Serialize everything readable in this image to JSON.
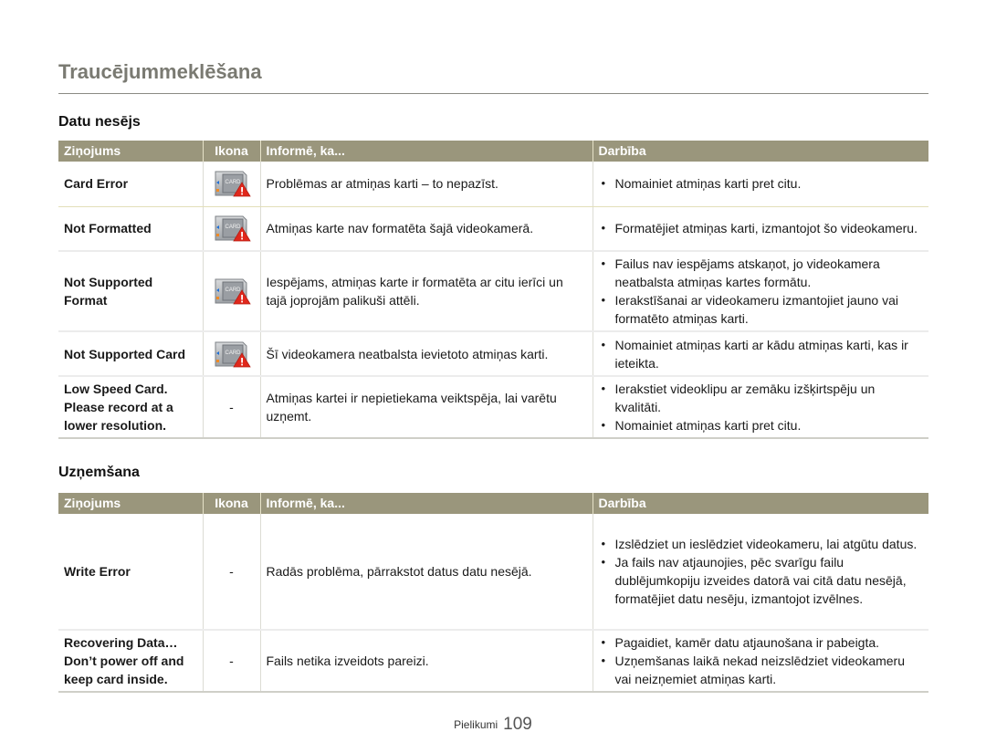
{
  "page": {
    "title": "Traucējummeklēšana",
    "footer": {
      "label": "Pielikumi",
      "page_number": "109"
    }
  },
  "colors": {
    "header_bg": "#9a967c",
    "header_text": "#ffffff",
    "title_text": "#7a7a72",
    "warning_red": "#e0281c"
  },
  "sections": [
    {
      "title": "Datu nesējs",
      "headers": {
        "message": "Ziņojums",
        "icon": "Ikona",
        "info": "Informē, ka...",
        "action": "Darbība"
      },
      "rows": [
        {
          "message": "Card Error",
          "icon": "card-error-icon",
          "info": "Problēmas ar atmiņas karti – to nepazīst.",
          "actions": [
            "Nomainiet atmiņas karti pret citu."
          ]
        },
        {
          "message": "Not Formatted",
          "icon": "card-error-icon",
          "info": "Atmiņas karte nav formatēta šajā videokamerā.",
          "actions": [
            "Formatējiet atmiņas karti, izmantojot šo videokameru."
          ]
        },
        {
          "message": "Not Supported Format",
          "icon": "card-error-icon",
          "info": "Iespējams, atmiņas karte ir formatēta ar citu ierīci un tajā joprojām palikuši attēli.",
          "actions": [
            "Failus nav iespējams atskaņot, jo videokamera neatbalsta atmiņas kartes formātu.",
            "Ierakstīšanai ar videokameru izmantojiet jauno vai formatēto atmiņas karti."
          ]
        },
        {
          "message": "Not Supported Card",
          "icon": "card-error-icon",
          "info": "Šī videokamera neatbalsta ievietoto atmiņas karti.",
          "actions": [
            "Nomainiet atmiņas karti ar kādu atmiņas karti, kas ir ieteikta."
          ]
        },
        {
          "message": "Low Speed Card. Please record at a lower resolution.",
          "icon": "-",
          "info": "Atmiņas kartei ir nepietiekama veiktspēja, lai varētu uzņemt.",
          "actions": [
            "Ierakstiet videoklipu ar zemāku izšķirtspēju un kvalitāti.",
            "Nomainiet atmiņas karti pret citu."
          ]
        }
      ]
    },
    {
      "title": "Uzņemšana",
      "headers": {
        "message": "Ziņojums",
        "icon": "Ikona",
        "info": "Informē, ka...",
        "action": "Darbība"
      },
      "rows": [
        {
          "message": "Write Error",
          "icon": "-",
          "info": "Radās problēma, pārrakstot datus datu nesējā.",
          "actions": [
            "Izslēdziet un ieslēdziet videokameru, lai atgūtu datus.",
            "Ja fails nav atjaunojies, pēc svarīgu failu dublējumkopiju izveides datorā vai citā datu nesējā, formatējiet datu nesēju, izmantojot izvēlnes."
          ]
        },
        {
          "message": "Recovering Data… Don’t power off and keep card inside.",
          "icon": "-",
          "info": "Fails netika izveidots pareizi.",
          "actions": [
            "Pagaidiet, kamēr datu atjaunošana ir pabeigta.",
            "Uzņemšanas laikā nekad neizslēdziet videokameru vai neizņemiet atmiņas karti."
          ]
        }
      ]
    }
  ]
}
